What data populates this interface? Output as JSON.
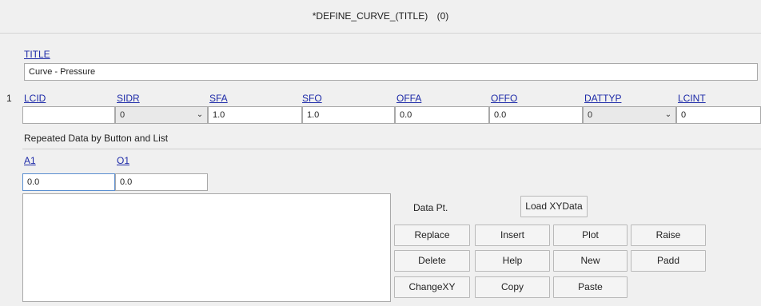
{
  "header": {
    "title": "*DEFINE_CURVE_(TITLE)",
    "count": "(0)"
  },
  "title_section": {
    "label": "TITLE",
    "value": "Curve - Pressure"
  },
  "card": {
    "row_number": "1",
    "fields": [
      {
        "label": "LCID",
        "value": ""
      },
      {
        "label": "SIDR",
        "value": "0"
      },
      {
        "label": "SFA",
        "value": "1.0"
      },
      {
        "label": "SFO",
        "value": "1.0"
      },
      {
        "label": "OFFA",
        "value": "0.0"
      },
      {
        "label": "OFFO",
        "value": "0.0"
      },
      {
        "label": "DATTYP",
        "value": "0"
      },
      {
        "label": "LCINT",
        "value": "0"
      }
    ]
  },
  "repeated": {
    "section_label": "Repeated Data by Button and List",
    "a1": {
      "label": "A1",
      "value": "0.0"
    },
    "o1": {
      "label": "O1",
      "value": "0.0"
    }
  },
  "buttons": {
    "data_pt_label": "Data Pt.",
    "load_xydata": "Load XYData",
    "replace": "Replace",
    "insert": "Insert",
    "plot": "Plot",
    "raise": "Raise",
    "delete": "Delete",
    "help": "Help",
    "new": "New",
    "padd": "Padd",
    "changexy": "ChangeXY",
    "copy": "Copy",
    "paste": "Paste"
  },
  "icons": {
    "dropdown": "chevron-down-icon"
  }
}
